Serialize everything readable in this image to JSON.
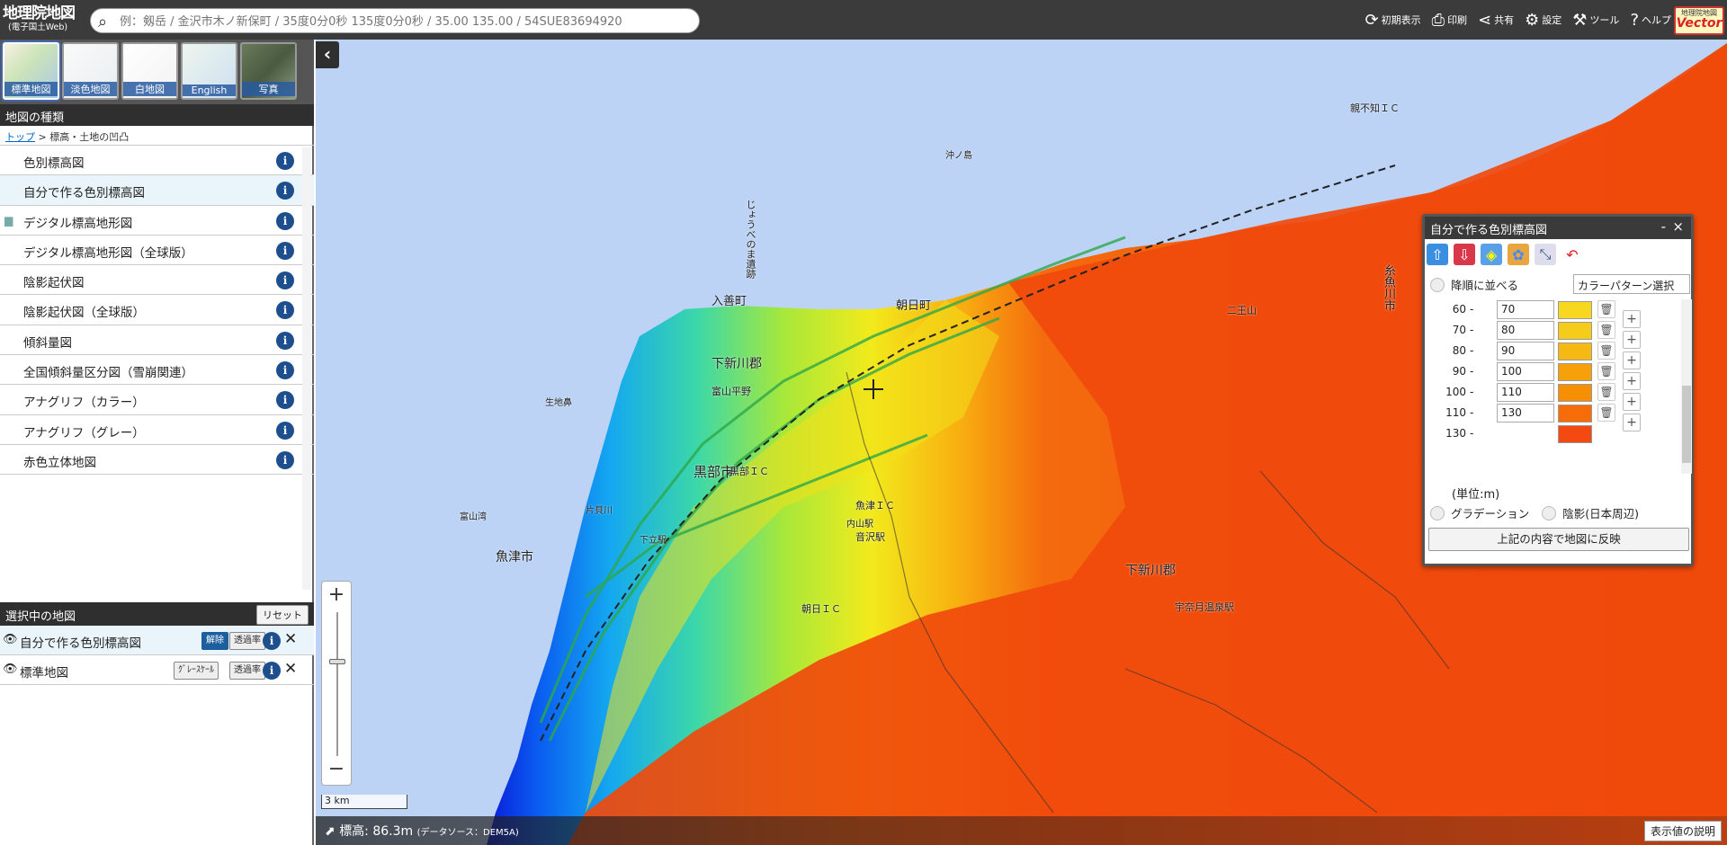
{
  "header": {
    "logo_line1": "地理院地図",
    "logo_line2": "(電子国土Web)",
    "search_placeholder": "例：剱岳 / 金沢市木ノ新保町 / 35度0分0秒 135度0分0秒 / 35.00 135.00 / 54SUE83694920",
    "toolbar": [
      {
        "icon": "refresh-icon",
        "glyph": "⟳",
        "label": "初期表示"
      },
      {
        "icon": "print-icon",
        "glyph": "⎙",
        "label": "印刷"
      },
      {
        "icon": "share-icon",
        "glyph": "⋖",
        "label": "共有"
      },
      {
        "icon": "gear-icon",
        "glyph": "⚙",
        "label": "設定"
      },
      {
        "icon": "tools-icon",
        "glyph": "⚒",
        "label": "ツール"
      },
      {
        "icon": "help-icon",
        "glyph": "?",
        "label": "ヘルプ"
      }
    ],
    "vector_small": "地理院地図",
    "vector_big": "Vector"
  },
  "basemaps": [
    {
      "label": "標準地図",
      "active": true
    },
    {
      "label": "淡色地図"
    },
    {
      "label": "白地図"
    },
    {
      "label": "English"
    },
    {
      "label": "写真"
    }
  ],
  "types": {
    "title": "地図の種類",
    "breadcrumb_top": "トップ",
    "breadcrumb_rest": " > 標高・土地の凹凸",
    "items": [
      {
        "label": "色別標高図"
      },
      {
        "label": "自分で作る色別標高図",
        "hl": true
      },
      {
        "label": "デジタル標高地形図",
        "folder": true
      },
      {
        "label": "デジタル標高地形図（全球版）"
      },
      {
        "label": "陰影起伏図"
      },
      {
        "label": "陰影起伏図（全球版）"
      },
      {
        "label": "傾斜量図"
      },
      {
        "label": "全国傾斜量区分図（雪崩関連）"
      },
      {
        "label": "アナグリフ（カラー）"
      },
      {
        "label": "アナグリフ（グレー）"
      },
      {
        "label": "赤色立体地図"
      }
    ]
  },
  "selected": {
    "title": "選択中の地図",
    "reset": "リセット",
    "rows": [
      {
        "label": "自分で作る色別標高図",
        "btn": "解除",
        "opacity": "透過率"
      },
      {
        "label": "標準地図",
        "btn": "ｸﾞﾚｰｽｹｰﾙ",
        "opacity": "透過率"
      }
    ]
  },
  "map": {
    "zoom_in": "+",
    "zoom_out": "−",
    "scale": "3 km",
    "elev_label": "標高:",
    "elev_value": "86.3m",
    "elev_source": "(データソース：DEM5A)",
    "explain": "表示値の説明"
  },
  "panel": {
    "title": "自分で作る色別標高図",
    "minimize": "-",
    "close": "×",
    "reverse": "降順に並べる",
    "pattern": "カラーパターン選択",
    "rows": [
      {
        "lo": "60",
        "hi": "70",
        "color": "#f7d720"
      },
      {
        "lo": "70",
        "hi": "80",
        "color": "#f6cc1a"
      },
      {
        "lo": "80",
        "hi": "90",
        "color": "#f6b812"
      },
      {
        "lo": "90",
        "hi": "100",
        "color": "#f7a10a"
      },
      {
        "lo": "100",
        "hi": "110",
        "color": "#f78f05"
      },
      {
        "lo": "110",
        "hi": "130",
        "color": "#f66c08"
      },
      {
        "lo": "130",
        "hi": "",
        "color": "#f44a12"
      }
    ],
    "unit": "(単位:m)",
    "gradation": "グラデーション",
    "shade": "陰影(日本周辺)",
    "apply": "上記の内容で地図に反映"
  },
  "places": [
    "じょうべのま遺跡",
    "入善町",
    "下新川郡",
    "黒部市",
    "魚津市",
    "富山平野",
    "朝日町",
    "下新川郡",
    "糸魚川市",
    "宇奈月温泉駅",
    "生地鼻",
    "片貝川",
    "音沢駅",
    "親不知ＩＣ",
    "沖ノ島",
    "黒部ＩＣ",
    "魚津ＩＣ",
    "下立駅",
    "二王山",
    "富山湾",
    "内山駅",
    "朝日ＩＣ"
  ]
}
